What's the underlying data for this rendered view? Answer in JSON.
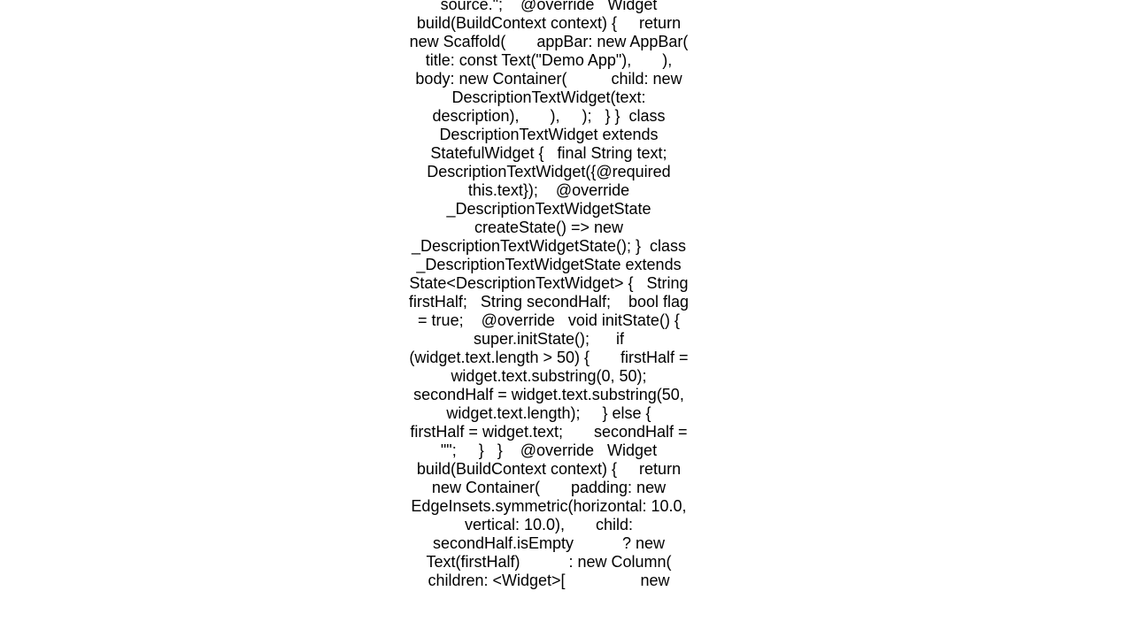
{
  "code_snippet": "source.\";    @override   Widget build(BuildContext context) {     return new Scaffold(       appBar: new AppBar(         title: const Text(\"Demo App\"),       ),       body: new Container(          child: new DescriptionTextWidget(text: description),       ),     );   } }  class DescriptionTextWidget extends StatefulWidget {   final String text;    DescriptionTextWidget({@required this.text});    @override   _DescriptionTextWidgetState createState() => new _DescriptionTextWidgetState(); }  class _DescriptionTextWidgetState extends State<DescriptionTextWidget> {   String firstHalf;   String secondHalf;    bool flag = true;    @override   void initState() {     super.initState();      if (widget.text.length > 50) {       firstHalf = widget.text.substring(0, 50);       secondHalf = widget.text.substring(50, widget.text.length);     } else {       firstHalf = widget.text;       secondHalf = \"\";     }   }    @override   Widget build(BuildContext context) {     return new Container(       padding: new EdgeInsets.symmetric(horizontal: 10.0, vertical: 10.0),       child: secondHalf.isEmpty           ? new Text(firstHalf)           : new Column(               children: <Widget>[                 new"
}
